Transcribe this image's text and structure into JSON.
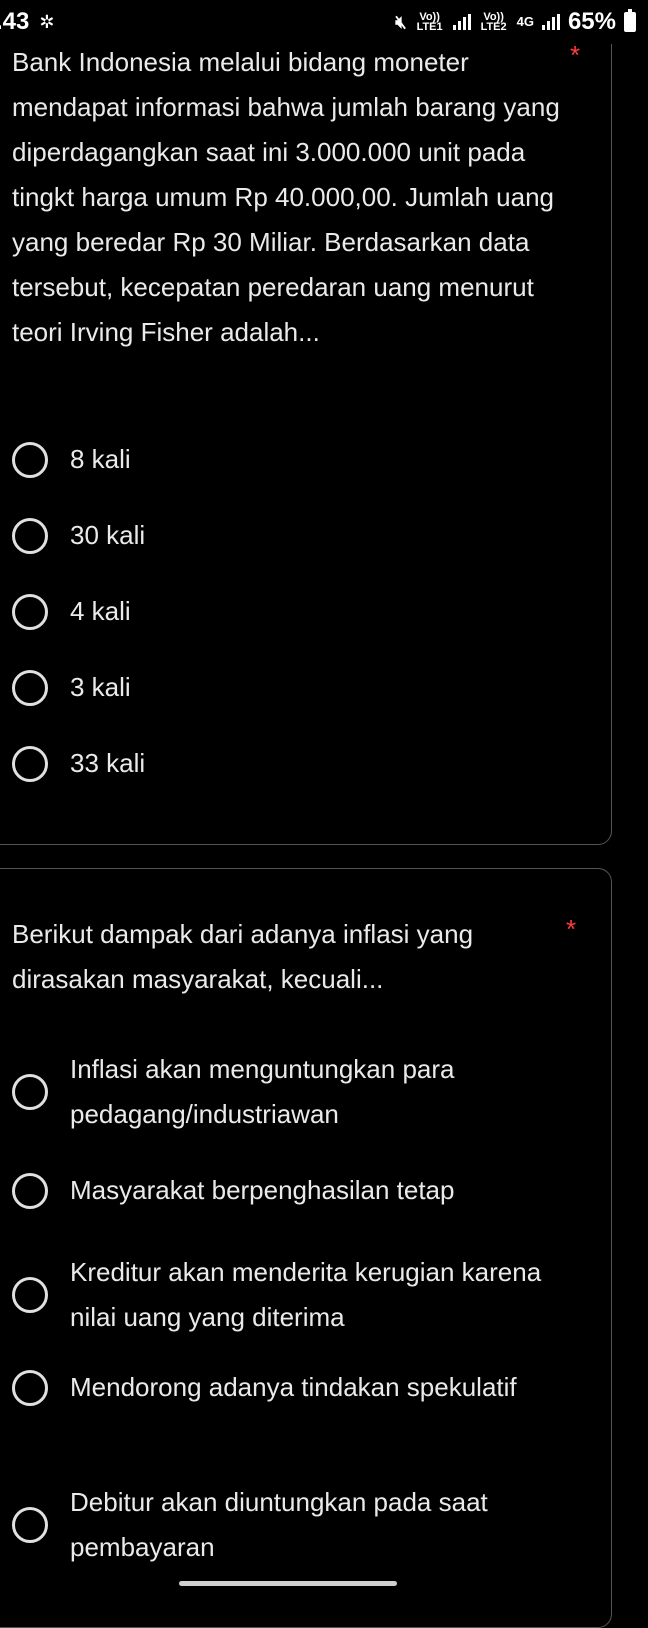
{
  "status": {
    "time": ".43",
    "sim1": "Vo)) LTE1",
    "sim2": "Vo)) LTE2",
    "network": "4G",
    "battery": "65%"
  },
  "q1": {
    "text": "Bank Indonesia melalui bidang moneter mendapat informasi bahwa jumlah barang yang diperdagangkan saat ini 3.000.000 unit pada tingkt harga umum Rp 40.000,00. Jumlah uang yang beredar Rp 30 Miliar. Berdasarkan data tersebut, kecepatan peredaran uang menurut teori Irving Fisher adalah...",
    "required": "*",
    "options": [
      "8 kali",
      "30 kali",
      "4 kali",
      "3 kali",
      "33 kali"
    ]
  },
  "q2": {
    "text": "Berikut dampak dari adanya inflasi yang dirasakan masyarakat, kecuali...",
    "required": "*",
    "options": [
      "Inflasi akan menguntungkan para pedagang/industriawan",
      "Masyarakat berpenghasilan tetap",
      "Kreditur akan menderita kerugian karena nilai uang yang diterima",
      "Mendorong adanya tindakan spekulatif",
      "Debitur akan diuntungkan pada saat pembayaran"
    ]
  }
}
